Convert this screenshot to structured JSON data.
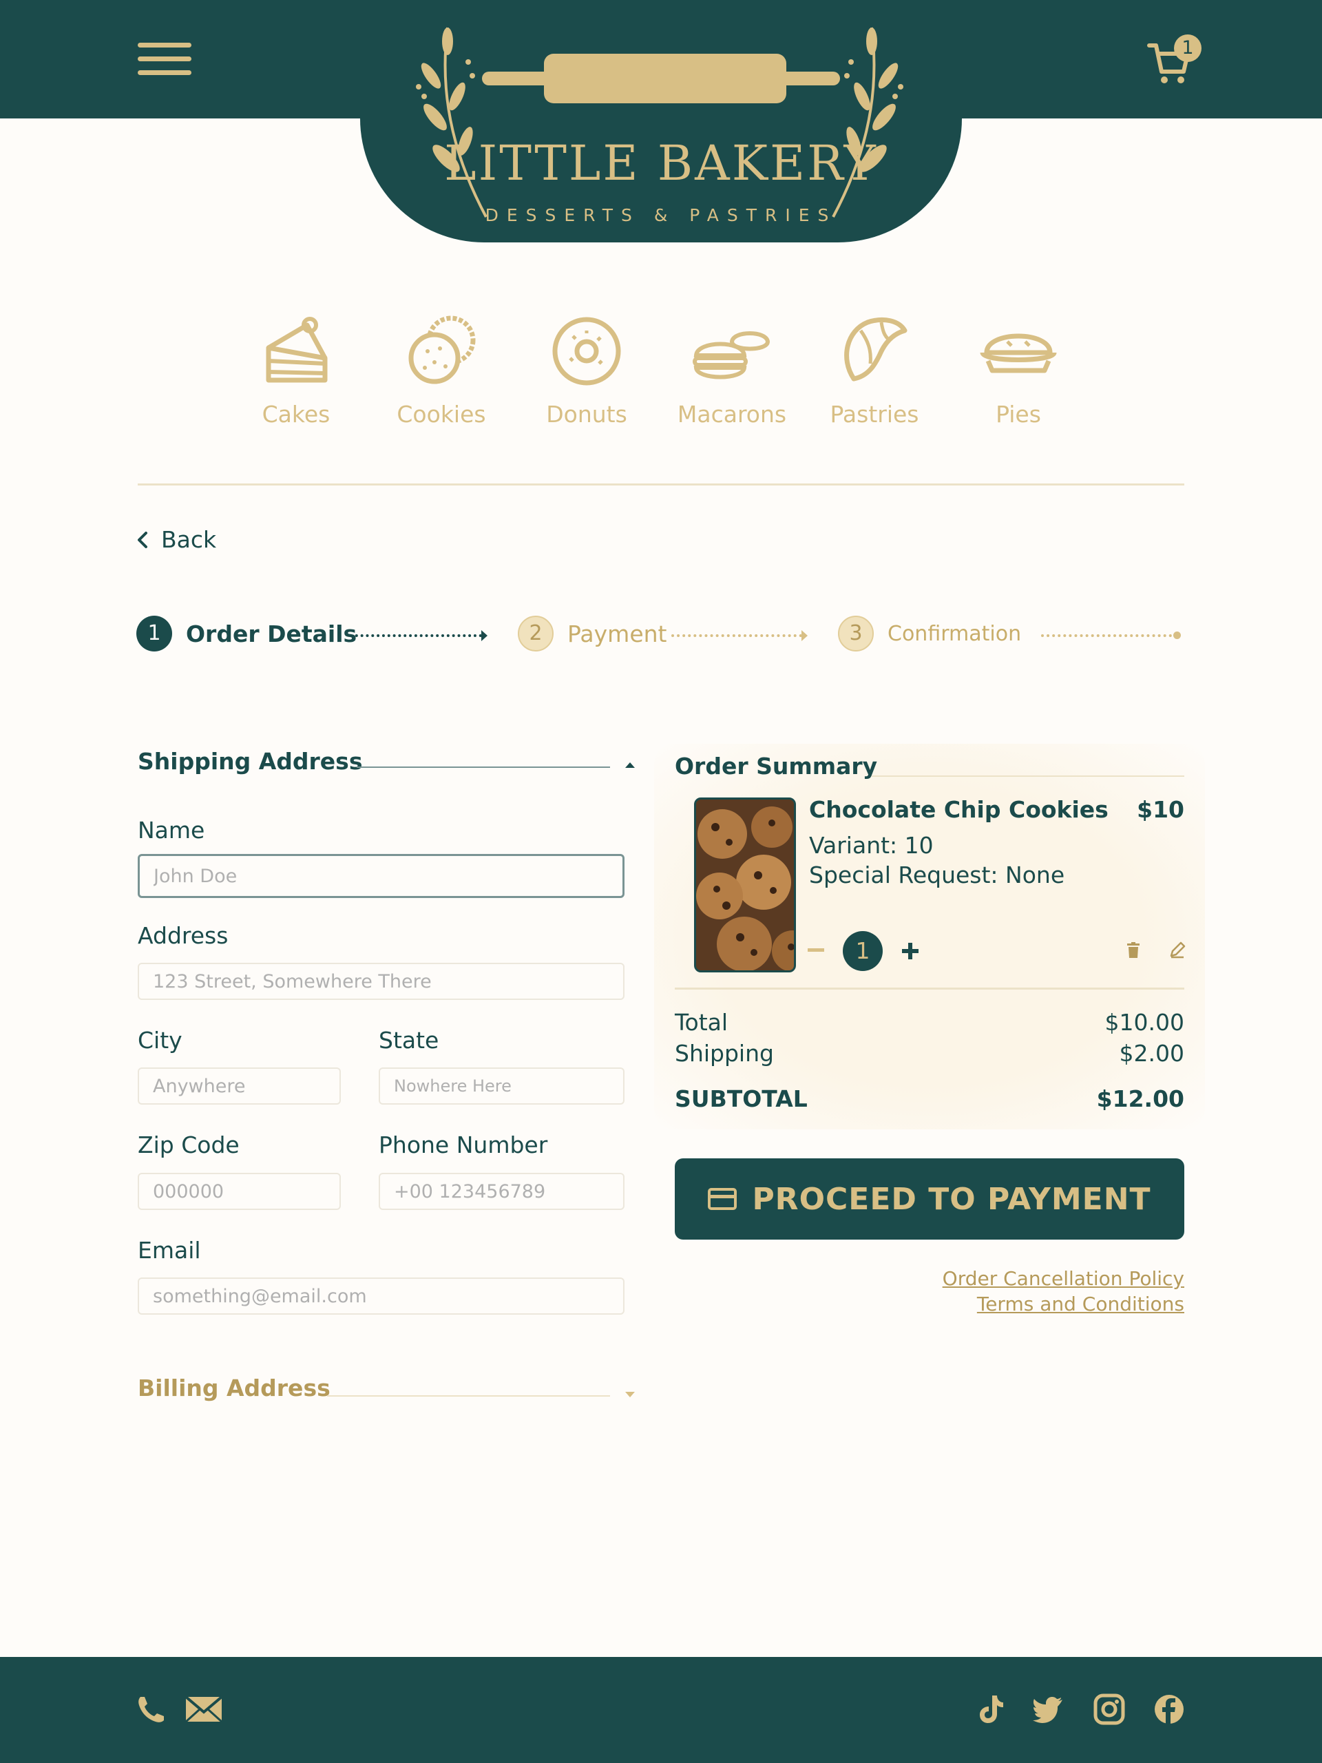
{
  "header": {
    "brand": "LITTLE BAKERY",
    "tagline": "DESSERTS & PASTRIES",
    "cart_count": "1",
    "menu_icon": "hamburger-menu-icon",
    "cart_icon": "shopping-cart-icon"
  },
  "categories": [
    {
      "label": "Cakes",
      "icon": "cake-slice-icon"
    },
    {
      "label": "Cookies",
      "icon": "cookies-icon"
    },
    {
      "label": "Donuts",
      "icon": "donut-icon"
    },
    {
      "label": "Macarons",
      "icon": "macarons-icon"
    },
    {
      "label": "Pastries",
      "icon": "croissant-icon"
    },
    {
      "label": "Pies",
      "icon": "pie-icon"
    }
  ],
  "nav": {
    "back_label": "Back"
  },
  "steps": [
    {
      "number": "1",
      "label": "Order Details",
      "state": "active"
    },
    {
      "number": "2",
      "label": "Payment",
      "state": "pending"
    },
    {
      "number": "3",
      "label": "Confirmation",
      "state": "pending"
    }
  ],
  "shipping": {
    "title": "Shipping Address",
    "name_label": "Name",
    "name_placeholder": "John Doe",
    "address_label": "Address",
    "address_placeholder": "123 Street, Somewhere There",
    "city_label": "City",
    "city_placeholder": "Anywhere",
    "state_label": "State",
    "state_placeholder": "Nowhere Here",
    "zip_label": "Zip Code",
    "zip_placeholder": "000000",
    "phone_label": "Phone Number",
    "phone_placeholder": "+00 123456789",
    "email_label": "Email",
    "email_placeholder": "something@email.com"
  },
  "billing": {
    "title": "Billing Address"
  },
  "summary": {
    "title": "Order Summary",
    "item": {
      "name": "Chocolate Chip Cookies",
      "price": "$10",
      "variant": "Variant: 10",
      "special_request": "Special Request: None",
      "quantity": "1"
    },
    "total_label": "Total",
    "total_value": "$10.00",
    "shipping_label": "Shipping",
    "shipping_value": "$2.00",
    "subtotal_label": "SUBTOTAL",
    "subtotal_value": "$12.00"
  },
  "actions": {
    "proceed_label": "PROCEED TO PAYMENT",
    "cancellation_link": "Order Cancellation Policy",
    "terms_link": "Terms and Conditions"
  },
  "footer": {
    "contact_icons": [
      "phone-icon",
      "mail-icon"
    ],
    "social_icons": [
      "tiktok-icon",
      "twitter-icon",
      "instagram-icon",
      "facebook-icon"
    ]
  },
  "colors": {
    "primary": "#1b4b4b",
    "gold": "#d8bf85",
    "dark_gold": "#b59a5a",
    "background": "#fefcf9"
  }
}
